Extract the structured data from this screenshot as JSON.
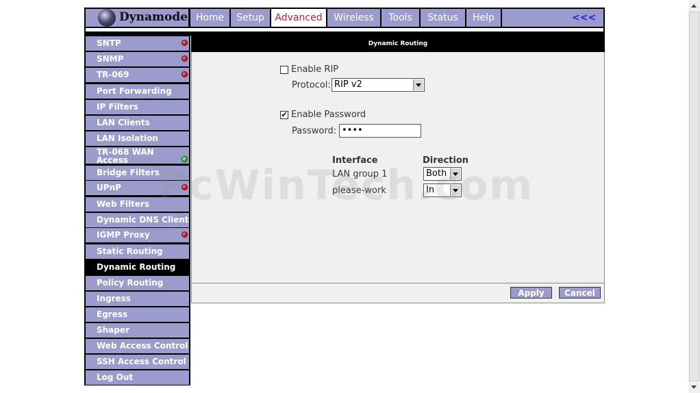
{
  "brand": {
    "name": "Dynamode"
  },
  "nav": {
    "tabs": [
      {
        "label": "Home"
      },
      {
        "label": "Setup"
      },
      {
        "label": "Advanced",
        "active": true
      },
      {
        "label": "Wireless"
      },
      {
        "label": "Tools"
      },
      {
        "label": "Status"
      },
      {
        "label": "Help"
      }
    ],
    "back_label": "<<<"
  },
  "sidebar": {
    "items": [
      {
        "label": "SNTP",
        "status": "red"
      },
      {
        "label": "SNMP",
        "status": "red"
      },
      {
        "label": "TR-069",
        "status": "red"
      },
      {
        "label": "Port Forwarding"
      },
      {
        "label": "IP Filters"
      },
      {
        "label": "LAN Clients"
      },
      {
        "label": "LAN Isolation"
      },
      {
        "label": "TR-068 WAN Access",
        "status": "green"
      },
      {
        "label": "Bridge Filters"
      },
      {
        "label": "UPnP",
        "status": "red"
      },
      {
        "label": "Web Filters"
      },
      {
        "label": "Dynamic DNS Client"
      },
      {
        "label": "IGMP Proxy",
        "status": "red"
      },
      {
        "label": "Static Routing"
      },
      {
        "label": "Dynamic Routing",
        "active": true
      },
      {
        "label": "Policy Routing"
      },
      {
        "label": "Ingress"
      },
      {
        "label": "Egress"
      },
      {
        "label": "Shaper"
      },
      {
        "label": "Web Access Control"
      },
      {
        "label": "SSH Access Control"
      },
      {
        "label": "Log Out"
      }
    ]
  },
  "main": {
    "title": "Dynamic Routing",
    "enable_rip": {
      "label": "Enable RIP",
      "checked": false
    },
    "protocol": {
      "label": "Protocol:",
      "value": "RIP v2"
    },
    "enable_password": {
      "label": "Enable Password",
      "checked": true
    },
    "password": {
      "label": "Password:",
      "value": "••••"
    },
    "table": {
      "headers": {
        "interface": "Interface",
        "direction": "Direction"
      },
      "rows": [
        {
          "interface": "LAN group 1",
          "direction": "Both"
        },
        {
          "interface": "please-work",
          "direction": "In"
        }
      ]
    },
    "apply_label": "Apply",
    "cancel_label": "Cancel"
  },
  "watermark": "PcWinTech.com",
  "colors": {
    "accent": "#9b9bcd",
    "active_tab_text": "#c0203a",
    "link": "#1e1ee0"
  }
}
